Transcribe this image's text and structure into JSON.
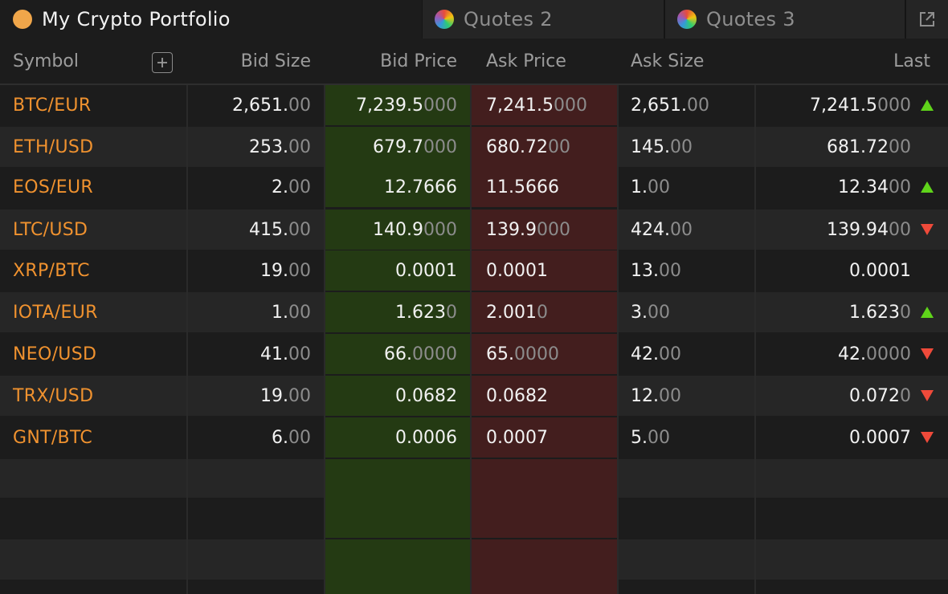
{
  "tabs": {
    "active": {
      "label": "My Crypto Portfolio"
    },
    "second": {
      "label": "Quotes 2"
    },
    "third": {
      "label": "Quotes 3"
    }
  },
  "columns": {
    "symbol": "Symbol",
    "bid_size": "Bid Size",
    "bid_price": "Bid Price",
    "ask_price": "Ask Price",
    "ask_size": "Ask Size",
    "last": "Last"
  },
  "colors": {
    "symbol": "#f0922f",
    "bid_bg": "#243a13",
    "ask_bg": "#431e1e",
    "up": "#5fd41a",
    "down": "#ef4a3a"
  },
  "rows": [
    {
      "symbol": "BTC/EUR",
      "bid_size": [
        "2,651.",
        "00"
      ],
      "bid_price": [
        "7,239.5",
        "000"
      ],
      "ask_price": [
        "7,241.5",
        "000"
      ],
      "ask_size": [
        "2,651.",
        "00"
      ],
      "last": [
        "7,241.5",
        "000"
      ],
      "trend": "up"
    },
    {
      "symbol": "ETH/USD",
      "bid_size": [
        "253.",
        "00"
      ],
      "bid_price": [
        "679.7",
        "000"
      ],
      "ask_price": [
        "680.72",
        "00"
      ],
      "ask_size": [
        "145.",
        "00"
      ],
      "last": [
        "681.72",
        "00"
      ],
      "trend": ""
    },
    {
      "symbol": "EOS/EUR",
      "bid_size": [
        "2.",
        "00"
      ],
      "bid_price": [
        "12.7666",
        ""
      ],
      "ask_price": [
        "11.5666",
        ""
      ],
      "ask_size": [
        "1.",
        "00"
      ],
      "last": [
        "12.34",
        "00"
      ],
      "trend": "up"
    },
    {
      "symbol": "LTC/USD",
      "bid_size": [
        "415.",
        "00"
      ],
      "bid_price": [
        "140.9",
        "000"
      ],
      "ask_price": [
        "139.9",
        "000"
      ],
      "ask_size": [
        "424.",
        "00"
      ],
      "last": [
        "139.94",
        "00"
      ],
      "trend": "down"
    },
    {
      "symbol": "XRP/BTC",
      "bid_size": [
        "19.",
        "00"
      ],
      "bid_price": [
        "0.0001",
        ""
      ],
      "ask_price": [
        "0.0001",
        ""
      ],
      "ask_size": [
        "13.",
        "00"
      ],
      "last": [
        "0.0001",
        ""
      ],
      "trend": ""
    },
    {
      "symbol": "IOTA/EUR",
      "bid_size": [
        "1.",
        "00"
      ],
      "bid_price": [
        "1.623",
        "0"
      ],
      "ask_price": [
        "2.001",
        "0"
      ],
      "ask_size": [
        "3.",
        "00"
      ],
      "last": [
        "1.623",
        "0"
      ],
      "trend": "up"
    },
    {
      "symbol": "NEO/USD",
      "bid_size": [
        "41.",
        "00"
      ],
      "bid_price": [
        "66.",
        "0000"
      ],
      "ask_price": [
        "65.",
        "0000"
      ],
      "ask_size": [
        "42.",
        "00"
      ],
      "last": [
        "42.",
        "0000"
      ],
      "trend": "down"
    },
    {
      "symbol": "TRX/USD",
      "bid_size": [
        "19.",
        "00"
      ],
      "bid_price": [
        "0.0682",
        ""
      ],
      "ask_price": [
        "0.0682",
        ""
      ],
      "ask_size": [
        "12.",
        "00"
      ],
      "last": [
        "0.072",
        "0"
      ],
      "trend": "down"
    },
    {
      "symbol": "GNT/BTC",
      "bid_size": [
        "6.",
        "00"
      ],
      "bid_price": [
        "0.0006",
        ""
      ],
      "ask_price": [
        "0.0007",
        ""
      ],
      "ask_size": [
        "5.",
        "00"
      ],
      "last": [
        "0.0007",
        ""
      ],
      "trend": "down"
    }
  ]
}
